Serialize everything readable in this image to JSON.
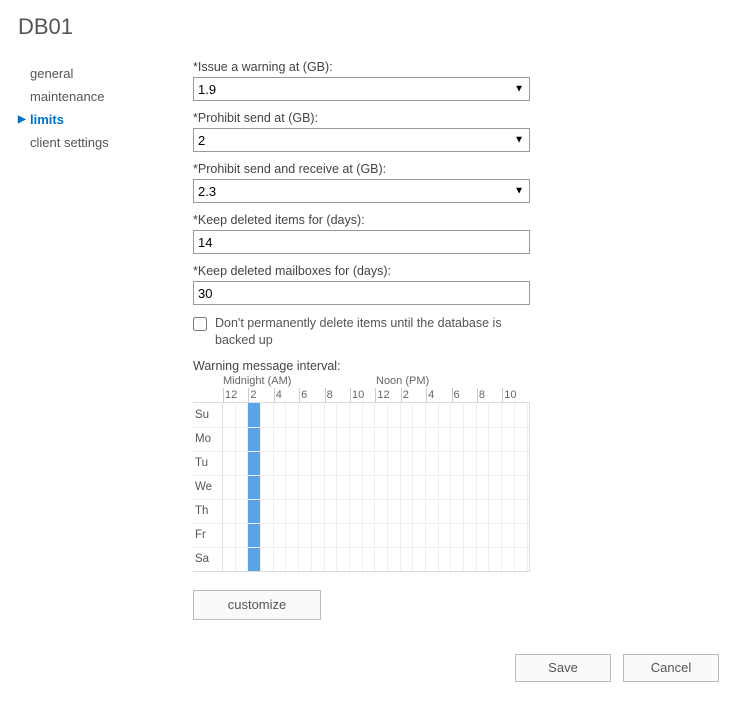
{
  "title": "DB01",
  "nav": {
    "items": [
      {
        "label": "general",
        "active": false
      },
      {
        "label": "maintenance",
        "active": false
      },
      {
        "label": "limits",
        "active": true
      },
      {
        "label": "client settings",
        "active": false
      }
    ]
  },
  "fields": {
    "issue_warning": {
      "label": "*Issue a warning at (GB):",
      "value": "1.9"
    },
    "prohibit_send": {
      "label": "*Prohibit send at (GB):",
      "value": "2"
    },
    "prohibit_send_receive": {
      "label": "*Prohibit send and receive at (GB):",
      "value": "2.3"
    },
    "keep_deleted_items": {
      "label": "*Keep deleted items for (days):",
      "value": "14"
    },
    "keep_deleted_mailboxes": {
      "label": "*Keep deleted mailboxes for (days):",
      "value": "30"
    },
    "no_perm_delete": {
      "label": "Don't permanently delete items until the database is backed up",
      "checked": false
    }
  },
  "interval": {
    "label": "Warning message interval:",
    "header_mid": "Midnight (AM)",
    "header_noon": "Noon (PM)",
    "hours": [
      "12",
      "2",
      "4",
      "6",
      "8",
      "10",
      "12",
      "2",
      "4",
      "6",
      "8",
      "10"
    ],
    "days": [
      "Su",
      "Mo",
      "Tu",
      "Th",
      "We",
      "Th",
      "Fr",
      "Sa"
    ],
    "days_display": [
      "Su",
      "Mo",
      "Tu",
      "We",
      "Th",
      "Fr",
      "Sa"
    ],
    "selected_half_hour_index": 2
  },
  "buttons": {
    "customize": "customize",
    "save": "Save",
    "cancel": "Cancel"
  }
}
